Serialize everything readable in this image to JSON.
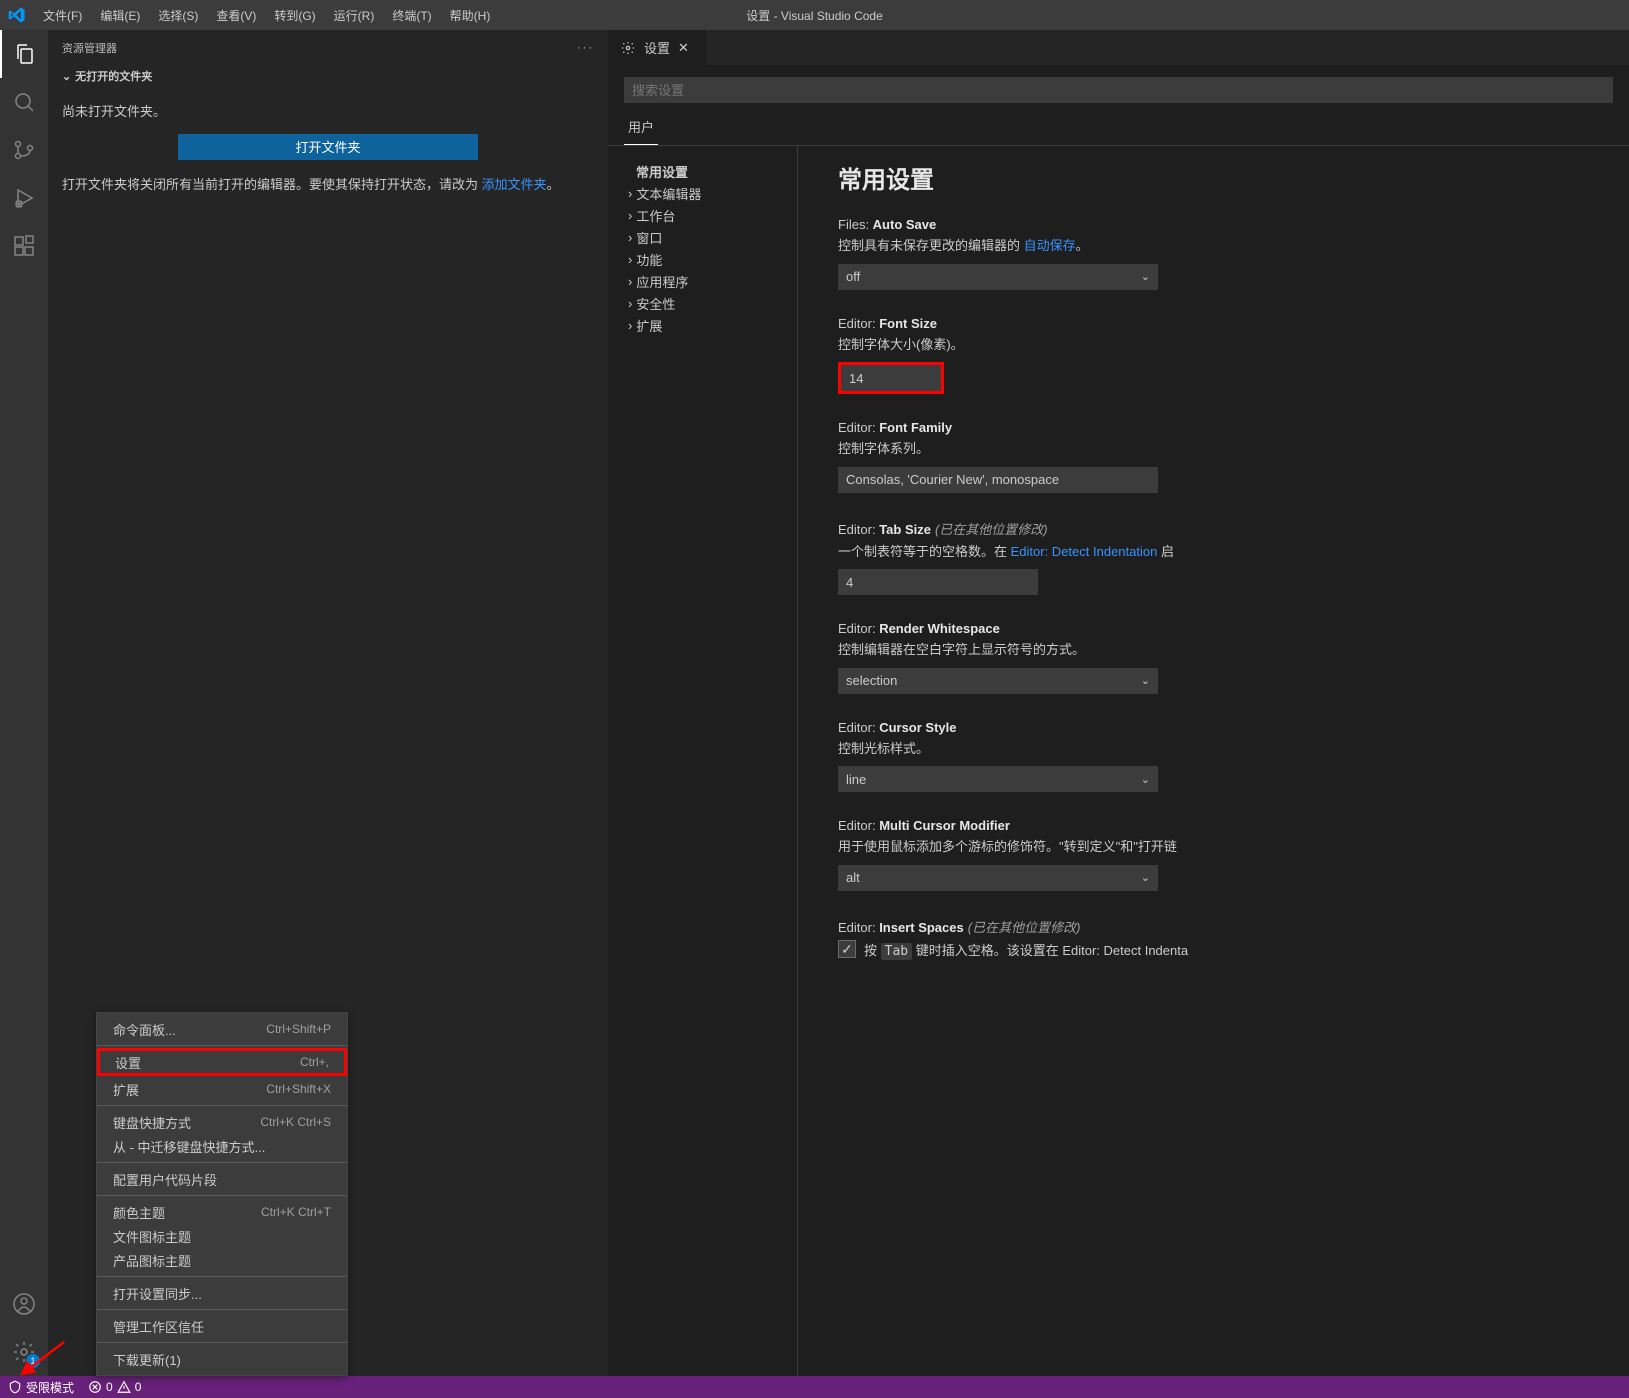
{
  "title": "设置 - Visual Studio Code",
  "menubar": [
    "文件(F)",
    "编辑(E)",
    "选择(S)",
    "查看(V)",
    "转到(G)",
    "运行(R)",
    "终端(T)",
    "帮助(H)"
  ],
  "explorer": {
    "title": "资源管理器",
    "section": "无打开的文件夹",
    "msg1": "尚未打开文件夹。",
    "openBtn": "打开文件夹",
    "msg2a": "打开文件夹将关闭所有当前打开的编辑器。要使其保持打开状态，请改为 ",
    "msg2link": "添加文件夹",
    "msg2b": "。"
  },
  "contextMenu": {
    "items": [
      {
        "label": "命令面板...",
        "shortcut": "Ctrl+Shift+P"
      }
    ],
    "items2": [
      {
        "label": "设置",
        "shortcut": "Ctrl+,"
      },
      {
        "label": "扩展",
        "shortcut": "Ctrl+Shift+X"
      }
    ],
    "items3": [
      {
        "label": "键盘快捷方式",
        "shortcut": "Ctrl+K Ctrl+S"
      },
      {
        "label": "从 - 中迁移键盘快捷方式...",
        "shortcut": ""
      }
    ],
    "items4": [
      {
        "label": "配置用户代码片段",
        "shortcut": ""
      }
    ],
    "items5": [
      {
        "label": "颜色主题",
        "shortcut": "Ctrl+K Ctrl+T"
      },
      {
        "label": "文件图标主题",
        "shortcut": ""
      },
      {
        "label": "产品图标主题",
        "shortcut": ""
      }
    ],
    "items6": [
      {
        "label": "打开设置同步...",
        "shortcut": ""
      }
    ],
    "items7": [
      {
        "label": "管理工作区信任",
        "shortcut": ""
      }
    ],
    "items8": [
      {
        "label": "下载更新(1)",
        "shortcut": ""
      }
    ]
  },
  "editor": {
    "tabTitle": "设置",
    "searchPlaceholder": "搜索设置",
    "scopeTab": "用户",
    "tree": {
      "active": "常用设置",
      "items": [
        "文本编辑器",
        "工作台",
        "窗口",
        "功能",
        "应用程序",
        "安全性",
        "扩展"
      ]
    },
    "heading": "常用设置",
    "settings": {
      "autoSave": {
        "cat": "Files: ",
        "name": "Auto Save",
        "desc1": "控制具有未保存更改的编辑器的 ",
        "link": "自动保存",
        "desc2": "。",
        "value": "off"
      },
      "fontSize": {
        "cat": "Editor: ",
        "name": "Font Size",
        "desc": "控制字体大小(像素)。",
        "value": "14"
      },
      "fontFamily": {
        "cat": "Editor: ",
        "name": "Font Family",
        "desc": "控制字体系列。",
        "value": "Consolas, 'Courier New', monospace"
      },
      "tabSize": {
        "cat": "Editor: ",
        "name": "Tab Size",
        "mod": "(已在其他位置修改)",
        "desc1": "一个制表符等于的空格数。在 ",
        "link": "Editor: Detect Indentation",
        "desc2": " 启",
        "value": "4"
      },
      "renderWs": {
        "cat": "Editor: ",
        "name": "Render Whitespace",
        "desc": "控制编辑器在空白字符上显示符号的方式。",
        "value": "selection"
      },
      "cursorStyle": {
        "cat": "Editor: ",
        "name": "Cursor Style",
        "desc": "控制光标样式。",
        "value": "line"
      },
      "multiCursor": {
        "cat": "Editor: ",
        "name": "Multi Cursor Modifier",
        "desc": "用于使用鼠标添加多个游标的修饰符。\"转到定义\"和\"打开链",
        "value": "alt"
      },
      "insertSpaces": {
        "cat": "Editor: ",
        "name": "Insert Spaces",
        "mod": "(已在其他位置修改)",
        "desc1": "按 ",
        "kbd": "Tab",
        "desc2": " 键时插入空格。该设置在 ",
        "link": "Editor: Detect Indenta"
      }
    }
  },
  "statusbar": {
    "restricted": "受限模式",
    "errors": "0",
    "warnings": "0"
  },
  "gearBadge": "1"
}
